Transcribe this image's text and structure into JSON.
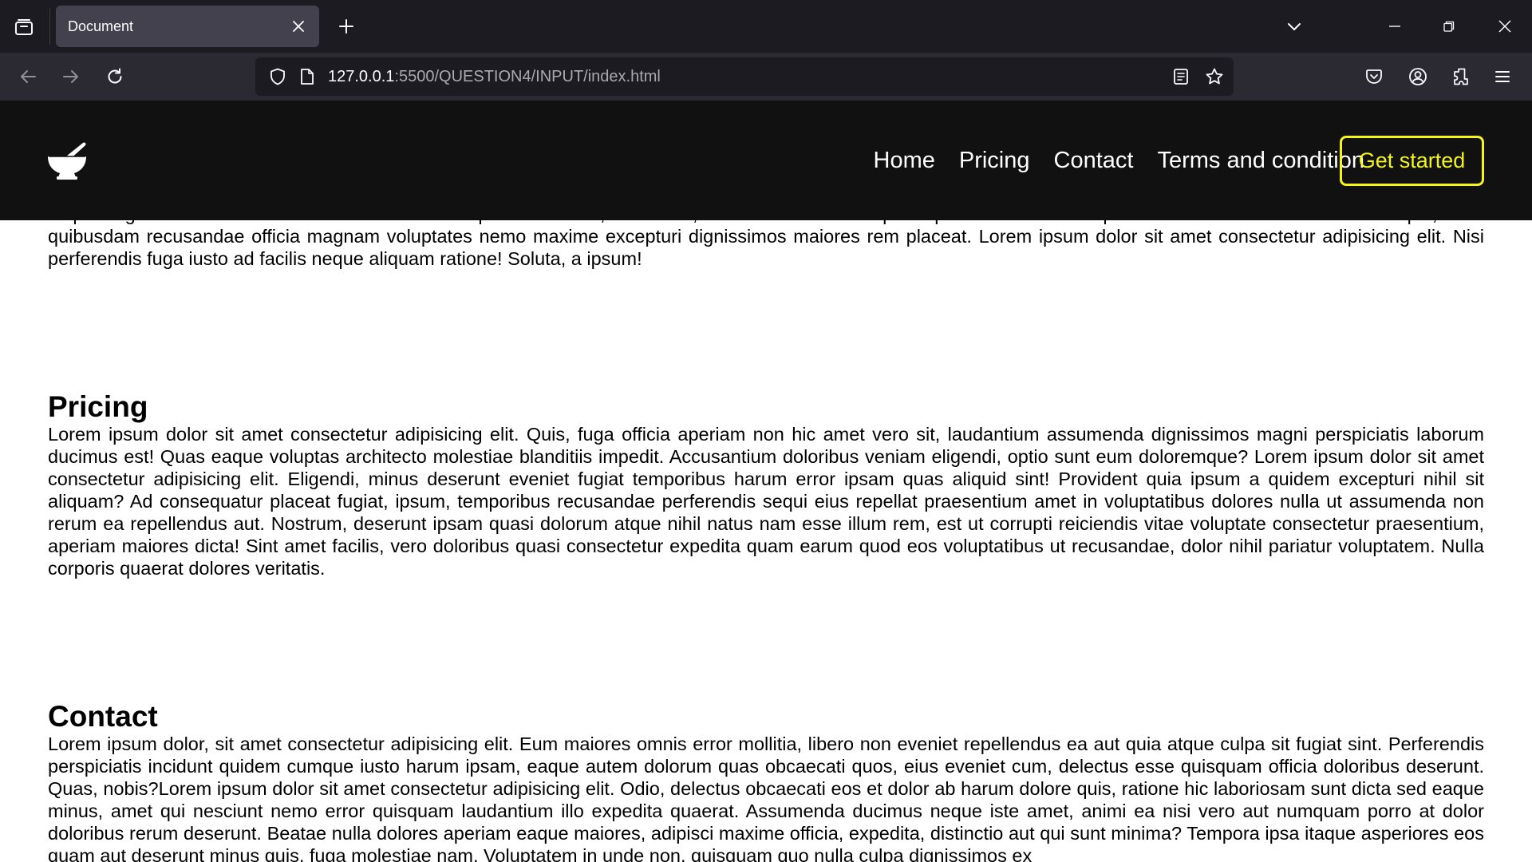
{
  "browser": {
    "tab_title": "Document",
    "url_host": "127.0.0.1",
    "url_path": ":5500/QUESTION4/INPUT/index.html"
  },
  "site": {
    "nav": [
      "Home",
      "Pricing",
      "Contact",
      "Terms and condition"
    ],
    "cta_label": "Get started",
    "accent_color": "#f4f416"
  },
  "content": {
    "intro_hidden_line": "adipisicing elit. Accusamus nemo ullam labore temporibus earum, esse nihil, maiores debitis corrupti aliquam molestias voluptates officiis ab nostrum? Ut similique, dicta",
    "intro_text": "quibusdam recusandae officia magnam voluptates nemo maxime excepturi dignissimos maiores rem placeat. Lorem ipsum dolor sit amet consectetur adipisicing elit. Nisi perferendis fuga iusto ad facilis neque aliquam ratione! Soluta, a ipsum!",
    "pricing_title": "Pricing",
    "pricing_text": "Lorem ipsum dolor sit amet consectetur adipisicing elit. Quis, fuga officia aperiam non hic amet vero sit, laudantium assumenda dignissimos magni perspiciatis laborum ducimus est! Quas eaque voluptas architecto molestiae blanditiis impedit. Accusantium doloribus veniam eligendi, optio sunt eum doloremque? Lorem ipsum dolor sit amet consectetur adipisicing elit. Eligendi, minus deserunt eveniet fugiat temporibus harum error ipsam quas aliquid sint! Provident quia ipsum a quidem excepturi nihil sit aliquam? Ad consequatur placeat fugiat, ipsum, temporibus recusandae perferendis sequi eius repellat praesentium amet in voluptatibus dolores nulla ut assumenda non rerum ea repellendus aut. Nostrum, deserunt ipsam quasi dolorum atque nihil natus nam esse illum rem, est ut corrupti reiciendis vitae voluptate consectetur praesentium, aperiam maiores dicta! Sint amet facilis, vero doloribus quasi consectetur expedita quam earum quod eos voluptatibus ut recusandae, dolor nihil pariatur voluptatem. Nulla corporis quaerat dolores veritatis.",
    "contact_title": "Contact",
    "contact_text": "Lorem ipsum dolor, sit amet consectetur adipisicing elit. Eum maiores omnis error mollitia, libero non eveniet repellendus ea aut quia atque culpa sit fugiat sint. Perferendis perspiciatis incidunt quidem cumque iusto harum ipsam, eaque autem dolorum quas obcaecati quos, eius eveniet cum, delectus esse quisquam officia doloribus deserunt. Quas, nobis?Lorem ipsum dolor sit amet consectetur adipisicing elit. Odio, delectus obcaecati eos et dolor ab harum dolore quis, ratione hic laboriosam sunt dicta sed eaque minus, amet qui nesciunt nemo error quisquam laudantium illo expedita quaerat. Assumenda ducimus neque iste amet, animi ea nisi vero aut numquam porro at dolor doloribus rerum deserunt. Beatae nulla dolores aperiam eaque maiores, adipisci maxime officia, expedita, distinctio aut qui sunt minima? Tempora ipsa itaque asperiores eos quam aut deserunt minus quis, fuga molestiae nam. Voluptatem in unde non, quisquam quo nulla culpa dignissimos ex"
  },
  "icons": {
    "tab_list": "tab-list-icon",
    "close": "close-icon",
    "new_tab": "plus-icon",
    "tabs_menu": "chevron-down-icon",
    "minimize": "minimize-icon",
    "restore": "restore-icon",
    "window_close": "window-close-icon",
    "back": "back-arrow-icon",
    "forward": "forward-arrow-icon",
    "reload": "reload-icon",
    "shield": "shield-icon",
    "page": "page-icon",
    "reader": "reader-view-icon",
    "bookmark": "star-icon",
    "pocket": "pocket-icon",
    "account": "account-icon",
    "extensions": "extensions-icon",
    "menu": "hamburger-menu-icon",
    "logo": "mortar-pestle-logo"
  }
}
